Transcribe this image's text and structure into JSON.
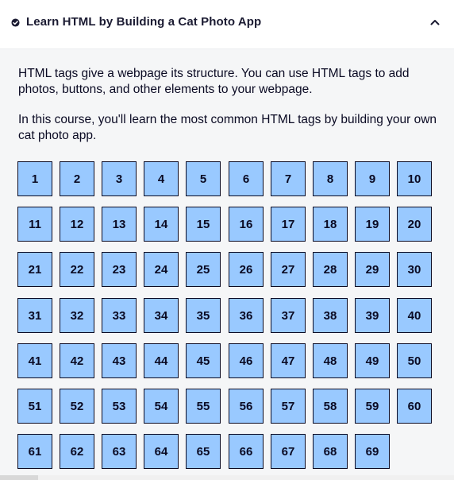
{
  "header": {
    "title": "Learn HTML by Building a Cat Photo App",
    "status_icon": "check-circle-icon",
    "toggle_icon": "chevron-up-icon"
  },
  "intro": {
    "paragraph1": "HTML tags give a webpage its structure. You can use HTML tags to add photos, buttons, and other elements to your webpage.",
    "paragraph2": "In this course, you'll learn the most common HTML tags by building your own cat photo app."
  },
  "steps": [
    "1",
    "2",
    "3",
    "4",
    "5",
    "6",
    "7",
    "8",
    "9",
    "10",
    "11",
    "12",
    "13",
    "14",
    "15",
    "16",
    "17",
    "18",
    "19",
    "20",
    "21",
    "22",
    "23",
    "24",
    "25",
    "26",
    "27",
    "28",
    "29",
    "30",
    "31",
    "32",
    "33",
    "34",
    "35",
    "36",
    "37",
    "38",
    "39",
    "40",
    "41",
    "42",
    "43",
    "44",
    "45",
    "46",
    "47",
    "48",
    "49",
    "50",
    "51",
    "52",
    "53",
    "54",
    "55",
    "56",
    "57",
    "58",
    "59",
    "60",
    "61",
    "62",
    "63",
    "64",
    "65",
    "66",
    "67",
    "68",
    "69"
  ],
  "colors": {
    "step_fill": "#99c9ff",
    "step_border": "#0a0a23",
    "panel_bg": "#f5f6f7",
    "header_bg": "#ffffff"
  }
}
